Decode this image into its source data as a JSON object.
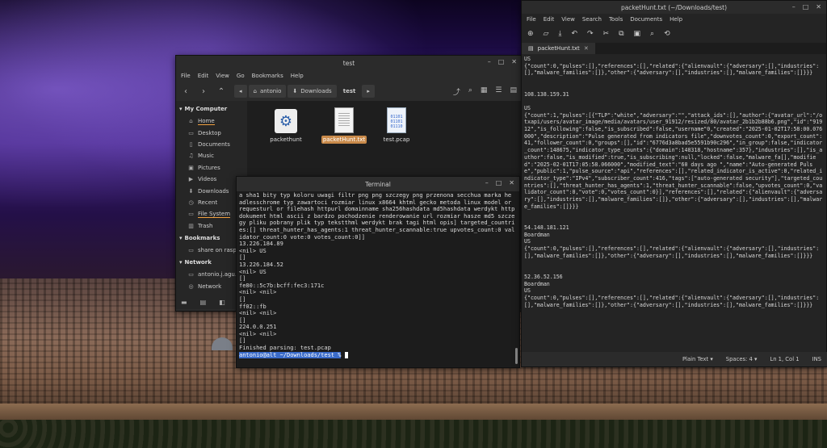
{
  "file_manager": {
    "title": "test",
    "menu": [
      "File",
      "Edit",
      "View",
      "Go",
      "Bookmarks",
      "Help"
    ],
    "breadcrumbs": [
      "antonio",
      "Downloads",
      "test"
    ],
    "sidebar": {
      "my_computer_label": "My Computer",
      "items": [
        {
          "label": "Home",
          "icon": "home-icon"
        },
        {
          "label": "Desktop",
          "icon": "desktop-icon"
        },
        {
          "label": "Documents",
          "icon": "documents-icon"
        },
        {
          "label": "Music",
          "icon": "music-icon"
        },
        {
          "label": "Pictures",
          "icon": "pictures-icon"
        },
        {
          "label": "Videos",
          "icon": "videos-icon"
        },
        {
          "label": "Downloads",
          "icon": "downloads-icon"
        },
        {
          "label": "Recent",
          "icon": "recent-icon"
        },
        {
          "label": "File System",
          "icon": "drive-icon"
        },
        {
          "label": "Trash",
          "icon": "trash-icon"
        }
      ],
      "bookmarks_label": "Bookmarks",
      "bookmarks": [
        {
          "label": "share on rasp...",
          "icon": "network-share-icon"
        }
      ],
      "network_label": "Network",
      "network": [
        {
          "label": "antonio.j.agu...",
          "icon": "network-share-icon"
        },
        {
          "label": "Network",
          "icon": "network-icon"
        }
      ]
    },
    "files": [
      {
        "name": "packethunt",
        "icon": "executable-gear-icon"
      },
      {
        "name": "packetHunt.txt",
        "icon": "text-file-icon",
        "selected": true
      },
      {
        "name": "test.pcap",
        "icon": "binary-file-icon"
      }
    ],
    "pcap_icon_text": "01101\n01101\n01110"
  },
  "terminal": {
    "title": "Terminal",
    "lines": [
      "a sha1 bity typ koloru uwagi filtr png png szczegy png przenona secchua marka he adlesschrome typ zawartoci rozmiar linux x8664 khtml gecko metoda linux model or requesturl or filehash httpurl domainname sha256hashdata md5hashdata werdykt http dokument html ascii z bardzo pochodzenie renderowanie url rozmiar hasze md5 szczegy pliku pobrany plik typ tekstthml werdykt brak tagi html opis] targeted_countries:[] threat_hunter_has_agents:1 threat_hunter_scannable:true upvotes_count:0 validator_count:0 vote:0 votes_count:0]]",
      "13.226.184.89",
      "<nil> US",
      "[]",
      "13.226.184.52",
      "<nil> US",
      "[]",
      "fe80::5c7b:bcff:fec3:171c",
      "<nil> <nil>",
      "[]",
      "ff02::fb",
      "<nil> <nil>",
      "[]",
      "224.0.0.251",
      "<nil> <nil>",
      "[]",
      "Finished parsing: test.pcap"
    ],
    "prompt": "antonio@alt ~/Downloads/test %"
  },
  "editor": {
    "title": "packetHunt.txt (~/Downloads/test)",
    "menu": [
      "File",
      "Edit",
      "View",
      "Search",
      "Tools",
      "Documents",
      "Help"
    ],
    "tab": "packetHunt.txt",
    "content": "US\n{\"count\":0,\"pulses\":[],\"references\":[],\"related\":{\"alienvault\":{\"adversary\":[],\"industries\":[],\"malware_families\":[]},\"other\":{\"adversary\":[],\"industries\":[],\"malware_families\":[]}}}\n\n\n108.138.159.31\n\nUS\n{\"count\":1,\"pulses\":[{\"TLP\":\"white\",\"adversary\":\"\",\"attack_ids\":[],\"author\":{\"avatar_url\":\"/otxapi/users/avatar_image/media/avatars/user_91912/resized/80/avatar_2b1b2b88b6.png\",\"id\":\"91912\",\"is_following\":false,\"is_subscribed\":false,\"username\"0,\"created\":\"2025-01-02T17:58:00.076000\",\"description\":\"Pulse generated from indicators file\",\"downvotes_count\":0,\"export_count\":41,\"follower_count\":0,\"groups\":[],\"id\":\"6776d3a8bad5e5591b90c296\",\"in_group\":false,\"indicator_count\":148675,\"indicator_type_counts\":{\"domain\":148318,\"hostname\":357},\"industries\":[],\"is_author\":false,\"is_modified\":true,\"is_subscribing\":null,\"locked\":false,\"malware_fa[],\"modified\":\"2025-02-01T17:05:58.066000\",\"modified_text\":\"60 days ago \",\"name\":\"Auto-generated Pulse\",\"public\":1,\"pulse_source\":\"api\",\"references\":[],\"related_indicator_is_active\":0,\"related_indicator_type\":\"IPv4\",\"subscriber_count\":416,\"tags\":[\"auto-generated security\"],\"targeted_countries\":[],\"threat_hunter_has_agents\":1,\"threat_hunter_scannable\":false,\"upvotes_count\":0,\"validator_count\":0,\"vote\":0,\"votes_count\":0}],\"references\":[],\"related\":{\"alienvault\":{\"adversary\":[],\"industries\":[],\"malware_families\":[]},\"other\":{\"adversary\":[],\"industries\":[],\"malware_families\":[]}}}\n\n\n54.148.181.121\nBoardman\nUS\n{\"count\":0,\"pulses\":[],\"references\":[],\"related\":{\"alienvault\":{\"adversary\":[],\"industries\":[],\"malware_families\":[]},\"other\":{\"adversary\":[],\"industries\":[],\"malware_families\":[]}}}\n\n\n52.36.52.156\nBoardman\nUS\n{\"count\":0,\"pulses\":[],\"references\":[],\"related\":{\"alienvault\":{\"adversary\":[],\"industries\":[],\"malware_families\":[]},\"other\":{\"adversary\":[],\"industries\":[],\"malware_families\":[]}}}",
    "status": {
      "language": "Plain Text",
      "spaces": "Spaces: 4",
      "position": "Ln 1, Col 1",
      "mode": "INS"
    }
  }
}
